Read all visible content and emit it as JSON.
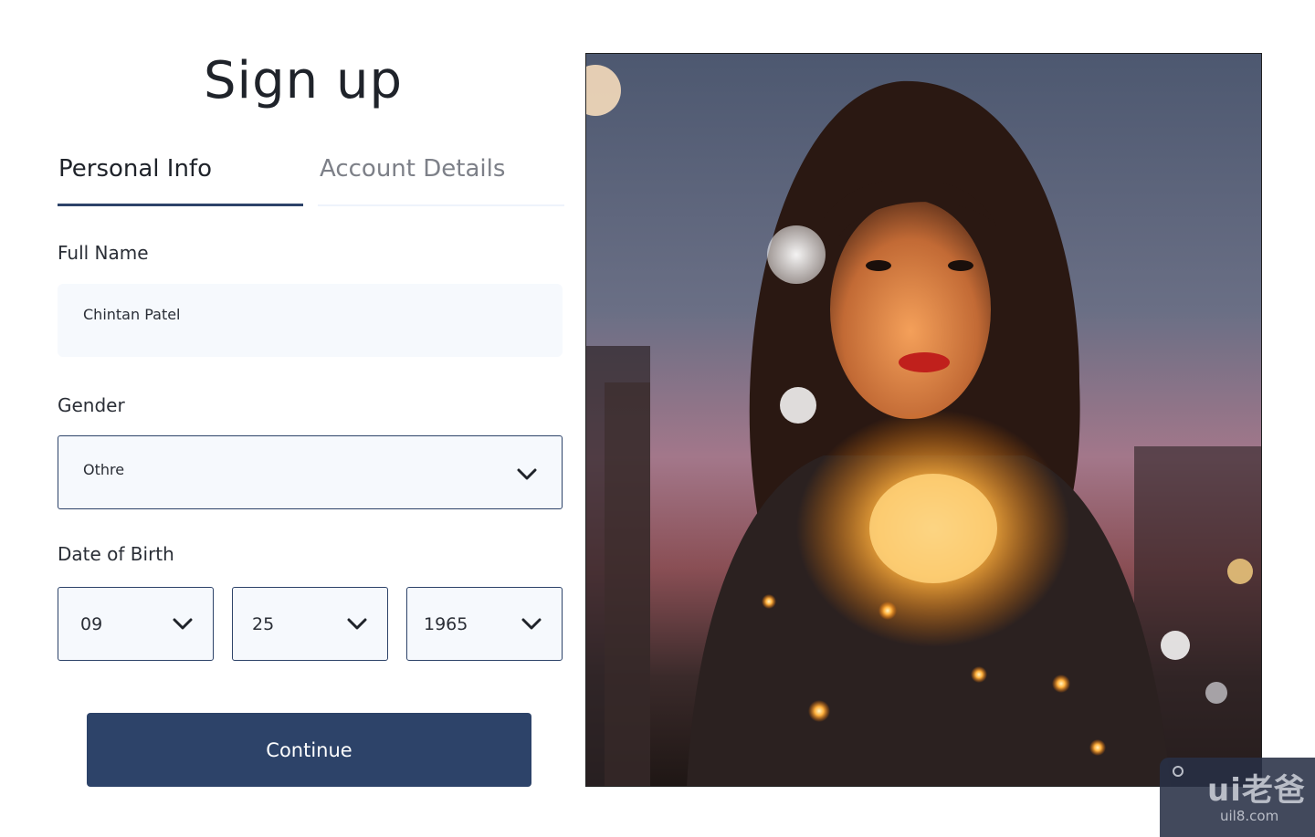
{
  "page": {
    "title": "Sign up"
  },
  "tabs": [
    {
      "label": "Personal Info",
      "active": true
    },
    {
      "label": "Account Details",
      "active": false
    }
  ],
  "form": {
    "full_name": {
      "label": "Full Name",
      "value": "Chintan Patel"
    },
    "gender": {
      "label": "Gender",
      "value": "Othre"
    },
    "dob": {
      "label": "Date of Birth",
      "month": "09",
      "day": "25",
      "year": "1965"
    }
  },
  "actions": {
    "continue_label": "Continue"
  },
  "watermark": {
    "logo": "ui老爸",
    "url": "uil8.com"
  },
  "colors": {
    "accent": "#2d4369",
    "field_bg": "#f6f9fd",
    "tab_inactive": "#7d8088"
  },
  "icons": {
    "select": "chevron-down-icon"
  }
}
